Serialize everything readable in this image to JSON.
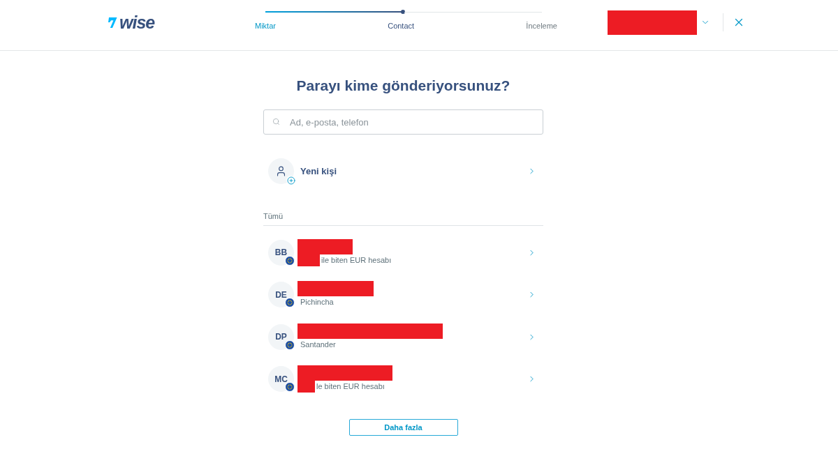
{
  "header": {
    "logo": {
      "text": "wise"
    },
    "stepper": {
      "steps": [
        {
          "label": "Miktar",
          "done": true,
          "selected": false
        },
        {
          "label": "Contact",
          "done": false,
          "selected": true
        },
        {
          "label": "İnceleme",
          "done": false,
          "selected": false
        }
      ]
    },
    "account": {
      "redacted": true
    }
  },
  "title": "Parayı kime gönderiyorsunuz?",
  "search": {
    "placeholder": "Ad, e-posta, telefon"
  },
  "new_contact": {
    "label": "Yeni kişi"
  },
  "section": {
    "label": "Tümü"
  },
  "contacts": [
    {
      "initials": "BB",
      "name_redacted": true,
      "number_redacted": true,
      "subtitle": "ile biten EUR hesabı"
    },
    {
      "initials": "DE",
      "name_redacted": true,
      "number_redacted": false,
      "subtitle": "Pichincha"
    },
    {
      "initials": "DP",
      "name_redacted": true,
      "number_redacted": false,
      "subtitle": "Santander"
    },
    {
      "initials": "MC",
      "name_redacted": true,
      "number_redacted": true,
      "subtitle": "le biten EUR hesabı"
    }
  ],
  "more_button": {
    "label": "Daha fazla"
  }
}
